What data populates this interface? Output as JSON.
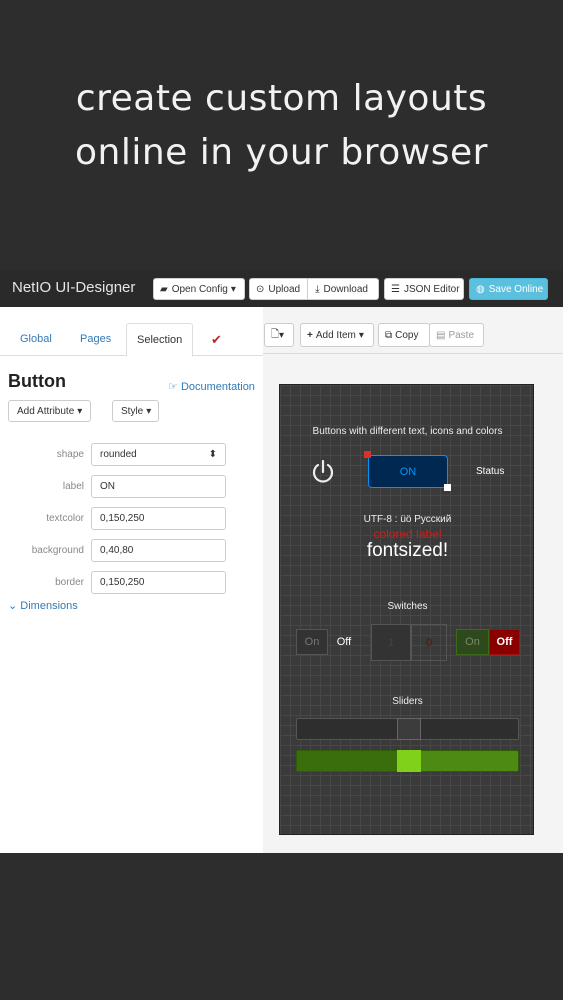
{
  "headline": {
    "line1": "create custom layouts",
    "line2": "online in your browser"
  },
  "toolbar": {
    "app_title": "NetIO UI-Designer",
    "open_config": "Open Config",
    "upload": "Upload",
    "download": "Download",
    "json_editor": "JSON Editor",
    "save_online": "Save Online"
  },
  "tabs": {
    "global": "Global",
    "pages": "Pages",
    "selection": "Selection",
    "check": "✔"
  },
  "panel": {
    "heading": "Button",
    "documentation": "Documentation",
    "add_attribute": "Add Attribute",
    "style": "Style",
    "dimensions": "Dimensions",
    "props": {
      "shape_label": "shape",
      "shape_value": "rounded",
      "label_label": "label",
      "label_value": "ON",
      "textcolor_label": "textcolor",
      "textcolor_value": "0,150,250",
      "background_label": "background",
      "background_value": "0,40,80",
      "border_label": "border",
      "border_value": "0,150,250"
    }
  },
  "right_toolbar": {
    "add_item": "Add Item",
    "copy": "Copy",
    "paste": "Paste"
  },
  "canvas": {
    "buttons_title": "Buttons with different text, icons and colors",
    "on_label": "ON",
    "status_label": "Status",
    "utf8_text": "UTF-8 : üö Русский",
    "colored_label": "colored label",
    "fontsized": "fontsized!",
    "switches_title": "Switches",
    "sw1_on": "On",
    "sw1_off": "Off",
    "sw2_a": "1",
    "sw2_b": "0",
    "sw3_on": "On",
    "sw3_off": "Off",
    "sliders_title": "Sliders",
    "slider1_level": 0.5,
    "slider2_level": 0.5
  },
  "colors": {
    "accent_blue": "#0096fa",
    "save_btn": "#5bc0de",
    "link": "#337ab7",
    "switch_green": "#3a6a1a",
    "switch_red": "#8a0000",
    "slider_green": "#7fd11a"
  }
}
